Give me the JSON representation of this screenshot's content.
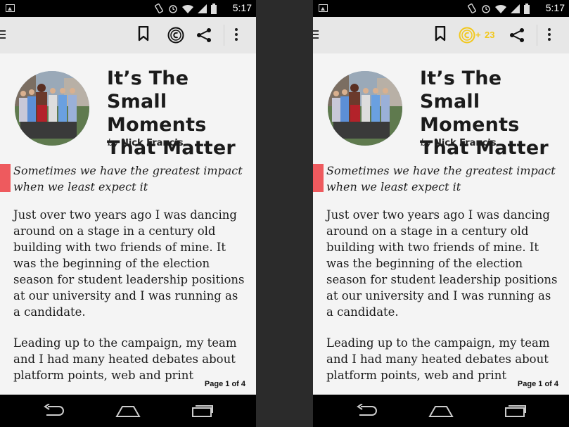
{
  "screens": [
    {
      "status": {
        "time": "5:17"
      },
      "coins": {
        "show_badge": false,
        "plus": "",
        "count": ""
      },
      "article": {
        "title": "It’s The Small Moments That Matter",
        "byline_prefix": "by",
        "author": "Nick Francis",
        "deck": "Sometimes we have the greatest impact when we least expect it",
        "paragraphs": [
          "Just over two years ago I was dancing around on a stage in a century old building with two friends of mine. It was the beginning of the election season for student leadership positions at our university and I was running as a candidate.",
          "Leading up to the campaign, my team and I had many heated debates about platform points, web and print"
        ]
      },
      "page_indicator": "Page 1 of 4"
    },
    {
      "status": {
        "time": "5:17"
      },
      "coins": {
        "show_badge": true,
        "plus": "+",
        "count": "23"
      },
      "article": {
        "title": "It’s The Small Moments That Matter",
        "byline_prefix": "by",
        "author": "Nick Francis",
        "deck": "Sometimes we have the greatest impact when we least expect it",
        "paragraphs": [
          "Just over two years ago I was dancing around on a stage in a century old building with two friends of mine. It was the beginning of the election season for student leadership positions at our university and I was running as a candidate.",
          "Leading up to the campaign, my team and I had many heated debates about platform points, web and print"
        ]
      },
      "page_indicator": "Page 1 of 4"
    }
  ],
  "colors": {
    "accent_quote_bar": "#ee5a5e",
    "coin_active": "#f2c81c",
    "coin_inactive": "#111111",
    "appbar_bg": "#e7e7e7",
    "page_bg": "#f4f4f4"
  },
  "icons": {
    "status": [
      "gallery-icon",
      "vibrate-icon",
      "alarm-icon",
      "wifi-icon",
      "signal-icon",
      "battery-icon"
    ],
    "appbar": [
      "menu-icon",
      "bookmark-icon",
      "coin-icon",
      "share-icon",
      "more-icon"
    ],
    "nav": [
      "back-icon",
      "home-icon",
      "recent-apps-icon"
    ]
  }
}
